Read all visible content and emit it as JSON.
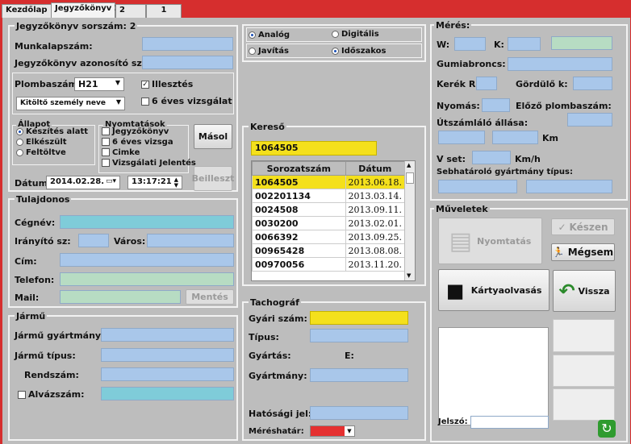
{
  "tabs": [
    "Kezdőlap",
    "Jegyzőkönyv 2",
    "2",
    "1"
  ],
  "jegyzokonyv": {
    "title": "Jegyzőkönyv sorszám: 2",
    "munkalap_label": "Munkalapszám:",
    "azonosito_label": "Jegyzőkönyv azonosító száma:",
    "plomba_label": "Plombaszám:",
    "plomba_value": "H21",
    "kitolto_value": "Kitöltő személy neve",
    "illesztes_label": "Illesztés",
    "hateves_label": "6 éves vizsgálat"
  },
  "allapot": {
    "title": "Állapot",
    "options": [
      "Készítés alatt",
      "Elkészült",
      "Feltöltve"
    ]
  },
  "nyomtatasok": {
    "title": "Nyomtatások",
    "options": [
      "Jegyzőkönyv",
      "6 éves vizsga",
      "Cimke",
      "Vizsgálati Jelentés"
    ]
  },
  "buttons": {
    "masol": "Másol",
    "beilleszt": "Beilleszt",
    "mentes": "Mentés",
    "nyomtatas": "Nyomtatás",
    "keszen": "Készen",
    "megsem": "Mégsem",
    "kartyaolvasas": "Kártyaolvasás",
    "vissza": "Vissza"
  },
  "datum": {
    "label": "Dátum:",
    "date": "2014.02.28.",
    "time": "13:17:21"
  },
  "tulajdonos": {
    "title": "Tulajdonos",
    "cegnev": "Cégnév:",
    "iranyito": "Irányító sz:",
    "varos": "Város:",
    "cim": "Cím:",
    "telefon": "Telefon:",
    "mail": "Mail:"
  },
  "jarmu": {
    "title": "Jármű",
    "gyartmany": "Jármű gyártmány:",
    "tipus": "Jármű típus:",
    "rendszam": "Rendszám:",
    "alvazszam": "Alvázszám:"
  },
  "mode": {
    "analog": "Analóg",
    "digitalis": "Digitális",
    "javitas": "Javítás",
    "idoszakos": "Időszakos"
  },
  "kereso": {
    "title": "Kereső",
    "search_value": "1064505",
    "col_sorozatszam": "Sorozatszám",
    "col_datum": "Dátum",
    "rows": [
      {
        "sn": "1064505",
        "date": "2013.06.18."
      },
      {
        "sn": "002201134",
        "date": "2013.03.14."
      },
      {
        "sn": "0024508",
        "date": "2013.09.11."
      },
      {
        "sn": "0030200",
        "date": "2013.02.01."
      },
      {
        "sn": "0066392",
        "date": "2013.09.25."
      },
      {
        "sn": "00965428",
        "date": "2013.08.08."
      },
      {
        "sn": "00970056",
        "date": "2013.11.20."
      }
    ]
  },
  "tachograf": {
    "title": "Tachográf",
    "gyari": "Gyári szám:",
    "tipus": "Típus:",
    "gyartas": "Gyártás:",
    "e_label": "E:",
    "gyartmany": "Gyártmány:",
    "hatosagi": "Hatósági jel:",
    "meresh": "Méréshatár:"
  },
  "meres": {
    "title": "Mérés:",
    "w": "W:",
    "k": "K:",
    "gumi": "Gumiabroncs:",
    "kerek": "Kerék R:",
    "gordulo": "Gördülő k:",
    "nyomas": "Nyomás:",
    "elozo": "Előző plombaszám:",
    "utszam": "Útszámláló állása:",
    "km": "Km",
    "vset": "V set:",
    "kmh": "Km/h",
    "sebhat": "Sebhatároló gyártmány  típus:"
  },
  "muveletek": {
    "title": "Műveletek",
    "jelszo": "Jelszó:"
  },
  "colors": {
    "background": "#d62e2e",
    "field": "#a9c7ea",
    "cyan": "#7fccd9",
    "yellow": "#f4e01c"
  }
}
